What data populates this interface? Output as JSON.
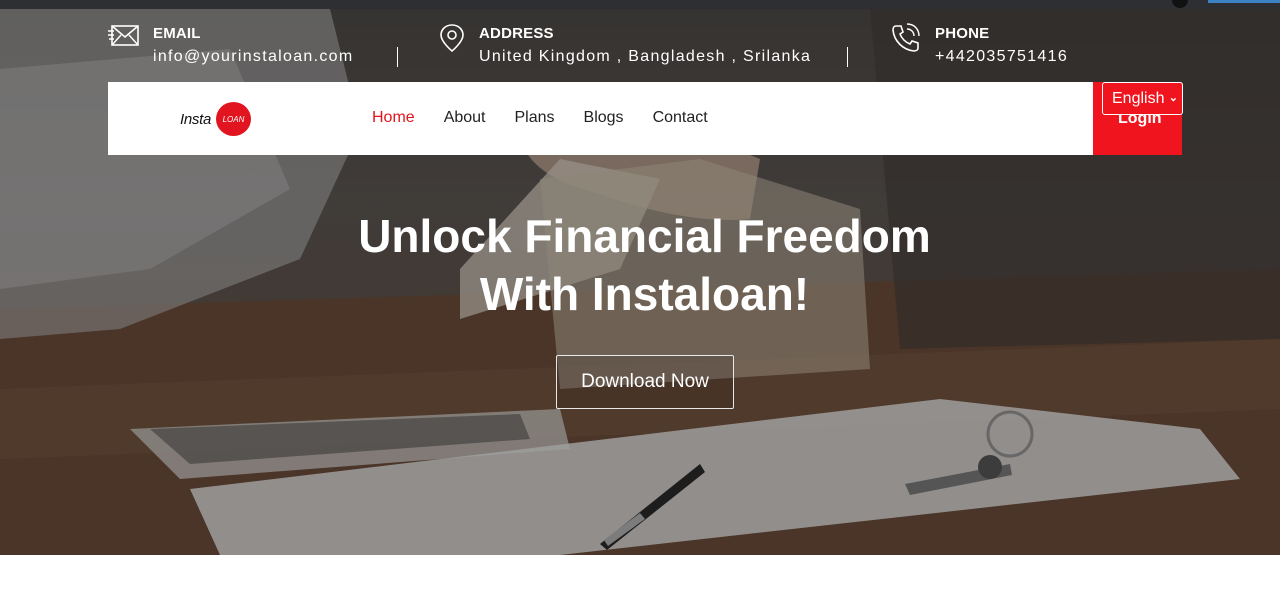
{
  "contact": {
    "email": {
      "icon": "envelope-icon",
      "label": "EMAIL",
      "value": "info@yourinstaloan.com"
    },
    "address": {
      "icon": "map-pin-icon",
      "label": "ADDRESS",
      "value": "United Kingdom , Bangladesh , Srilanka"
    },
    "phone": {
      "icon": "phone-icon",
      "label": "PHONE",
      "value": "+442035751416"
    }
  },
  "brand": {
    "text": "Insta",
    "badge": "LOAN",
    "color": "#e1141f"
  },
  "nav": {
    "items": [
      {
        "label": "Home",
        "active": true
      },
      {
        "label": "About",
        "active": false
      },
      {
        "label": "Plans",
        "active": false
      },
      {
        "label": "Blogs",
        "active": false
      },
      {
        "label": "Contact",
        "active": false
      }
    ],
    "active_color": "#e1141f"
  },
  "login": {
    "label": "Login",
    "color": "#f0141e"
  },
  "language": {
    "selected": "English",
    "icon": "chevron-down-icon"
  },
  "hero": {
    "title_line1": "Unlock Financial Freedom",
    "title_line2": "With Instaloan!",
    "cta_label": "Download Now"
  }
}
